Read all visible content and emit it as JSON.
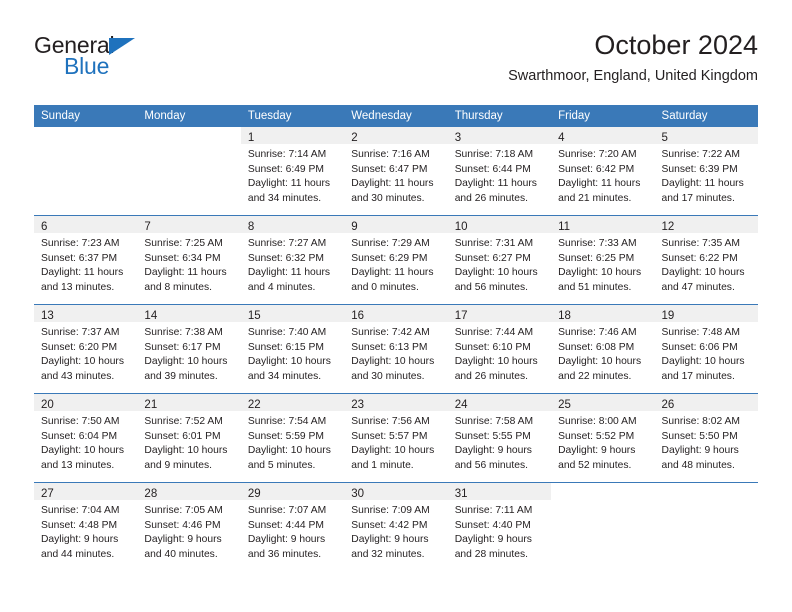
{
  "brand": {
    "name_top": "General",
    "name_bottom": "Blue",
    "triangle_icon": "blue-triangle-icon",
    "accent_color": "#1f72bd"
  },
  "header": {
    "title": "October 2024",
    "subtitle": "Swarthmoor, England, United Kingdom"
  },
  "theme": {
    "header_blue": "#3a79b8",
    "day_band_gray": "#f0f0f0",
    "text": "#231f20"
  },
  "calendar": {
    "weekday_headers": [
      "Sunday",
      "Monday",
      "Tuesday",
      "Wednesday",
      "Thursday",
      "Friday",
      "Saturday"
    ],
    "weeks": [
      [
        {
          "day": "",
          "lines": []
        },
        {
          "day": "",
          "lines": []
        },
        {
          "day": "1",
          "lines": [
            "Sunrise: 7:14 AM",
            "Sunset: 6:49 PM",
            "Daylight: 11 hours",
            "and 34 minutes."
          ]
        },
        {
          "day": "2",
          "lines": [
            "Sunrise: 7:16 AM",
            "Sunset: 6:47 PM",
            "Daylight: 11 hours",
            "and 30 minutes."
          ]
        },
        {
          "day": "3",
          "lines": [
            "Sunrise: 7:18 AM",
            "Sunset: 6:44 PM",
            "Daylight: 11 hours",
            "and 26 minutes."
          ]
        },
        {
          "day": "4",
          "lines": [
            "Sunrise: 7:20 AM",
            "Sunset: 6:42 PM",
            "Daylight: 11 hours",
            "and 21 minutes."
          ]
        },
        {
          "day": "5",
          "lines": [
            "Sunrise: 7:22 AM",
            "Sunset: 6:39 PM",
            "Daylight: 11 hours",
            "and 17 minutes."
          ]
        }
      ],
      [
        {
          "day": "6",
          "lines": [
            "Sunrise: 7:23 AM",
            "Sunset: 6:37 PM",
            "Daylight: 11 hours",
            "and 13 minutes."
          ]
        },
        {
          "day": "7",
          "lines": [
            "Sunrise: 7:25 AM",
            "Sunset: 6:34 PM",
            "Daylight: 11 hours",
            "and 8 minutes."
          ]
        },
        {
          "day": "8",
          "lines": [
            "Sunrise: 7:27 AM",
            "Sunset: 6:32 PM",
            "Daylight: 11 hours",
            "and 4 minutes."
          ]
        },
        {
          "day": "9",
          "lines": [
            "Sunrise: 7:29 AM",
            "Sunset: 6:29 PM",
            "Daylight: 11 hours",
            "and 0 minutes."
          ]
        },
        {
          "day": "10",
          "lines": [
            "Sunrise: 7:31 AM",
            "Sunset: 6:27 PM",
            "Daylight: 10 hours",
            "and 56 minutes."
          ]
        },
        {
          "day": "11",
          "lines": [
            "Sunrise: 7:33 AM",
            "Sunset: 6:25 PM",
            "Daylight: 10 hours",
            "and 51 minutes."
          ]
        },
        {
          "day": "12",
          "lines": [
            "Sunrise: 7:35 AM",
            "Sunset: 6:22 PM",
            "Daylight: 10 hours",
            "and 47 minutes."
          ]
        }
      ],
      [
        {
          "day": "13",
          "lines": [
            "Sunrise: 7:37 AM",
            "Sunset: 6:20 PM",
            "Daylight: 10 hours",
            "and 43 minutes."
          ]
        },
        {
          "day": "14",
          "lines": [
            "Sunrise: 7:38 AM",
            "Sunset: 6:17 PM",
            "Daylight: 10 hours",
            "and 39 minutes."
          ]
        },
        {
          "day": "15",
          "lines": [
            "Sunrise: 7:40 AM",
            "Sunset: 6:15 PM",
            "Daylight: 10 hours",
            "and 34 minutes."
          ]
        },
        {
          "day": "16",
          "lines": [
            "Sunrise: 7:42 AM",
            "Sunset: 6:13 PM",
            "Daylight: 10 hours",
            "and 30 minutes."
          ]
        },
        {
          "day": "17",
          "lines": [
            "Sunrise: 7:44 AM",
            "Sunset: 6:10 PM",
            "Daylight: 10 hours",
            "and 26 minutes."
          ]
        },
        {
          "day": "18",
          "lines": [
            "Sunrise: 7:46 AM",
            "Sunset: 6:08 PM",
            "Daylight: 10 hours",
            "and 22 minutes."
          ]
        },
        {
          "day": "19",
          "lines": [
            "Sunrise: 7:48 AM",
            "Sunset: 6:06 PM",
            "Daylight: 10 hours",
            "and 17 minutes."
          ]
        }
      ],
      [
        {
          "day": "20",
          "lines": [
            "Sunrise: 7:50 AM",
            "Sunset: 6:04 PM",
            "Daylight: 10 hours",
            "and 13 minutes."
          ]
        },
        {
          "day": "21",
          "lines": [
            "Sunrise: 7:52 AM",
            "Sunset: 6:01 PM",
            "Daylight: 10 hours",
            "and 9 minutes."
          ]
        },
        {
          "day": "22",
          "lines": [
            "Sunrise: 7:54 AM",
            "Sunset: 5:59 PM",
            "Daylight: 10 hours",
            "and 5 minutes."
          ]
        },
        {
          "day": "23",
          "lines": [
            "Sunrise: 7:56 AM",
            "Sunset: 5:57 PM",
            "Daylight: 10 hours",
            "and 1 minute."
          ]
        },
        {
          "day": "24",
          "lines": [
            "Sunrise: 7:58 AM",
            "Sunset: 5:55 PM",
            "Daylight: 9 hours",
            "and 56 minutes."
          ]
        },
        {
          "day": "25",
          "lines": [
            "Sunrise: 8:00 AM",
            "Sunset: 5:52 PM",
            "Daylight: 9 hours",
            "and 52 minutes."
          ]
        },
        {
          "day": "26",
          "lines": [
            "Sunrise: 8:02 AM",
            "Sunset: 5:50 PM",
            "Daylight: 9 hours",
            "and 48 minutes."
          ]
        }
      ],
      [
        {
          "day": "27",
          "lines": [
            "Sunrise: 7:04 AM",
            "Sunset: 4:48 PM",
            "Daylight: 9 hours",
            "and 44 minutes."
          ]
        },
        {
          "day": "28",
          "lines": [
            "Sunrise: 7:05 AM",
            "Sunset: 4:46 PM",
            "Daylight: 9 hours",
            "and 40 minutes."
          ]
        },
        {
          "day": "29",
          "lines": [
            "Sunrise: 7:07 AM",
            "Sunset: 4:44 PM",
            "Daylight: 9 hours",
            "and 36 minutes."
          ]
        },
        {
          "day": "30",
          "lines": [
            "Sunrise: 7:09 AM",
            "Sunset: 4:42 PM",
            "Daylight: 9 hours",
            "and 32 minutes."
          ]
        },
        {
          "day": "31",
          "lines": [
            "Sunrise: 7:11 AM",
            "Sunset: 4:40 PM",
            "Daylight: 9 hours",
            "and 28 minutes."
          ]
        },
        {
          "day": "",
          "lines": []
        },
        {
          "day": "",
          "lines": []
        }
      ]
    ]
  }
}
